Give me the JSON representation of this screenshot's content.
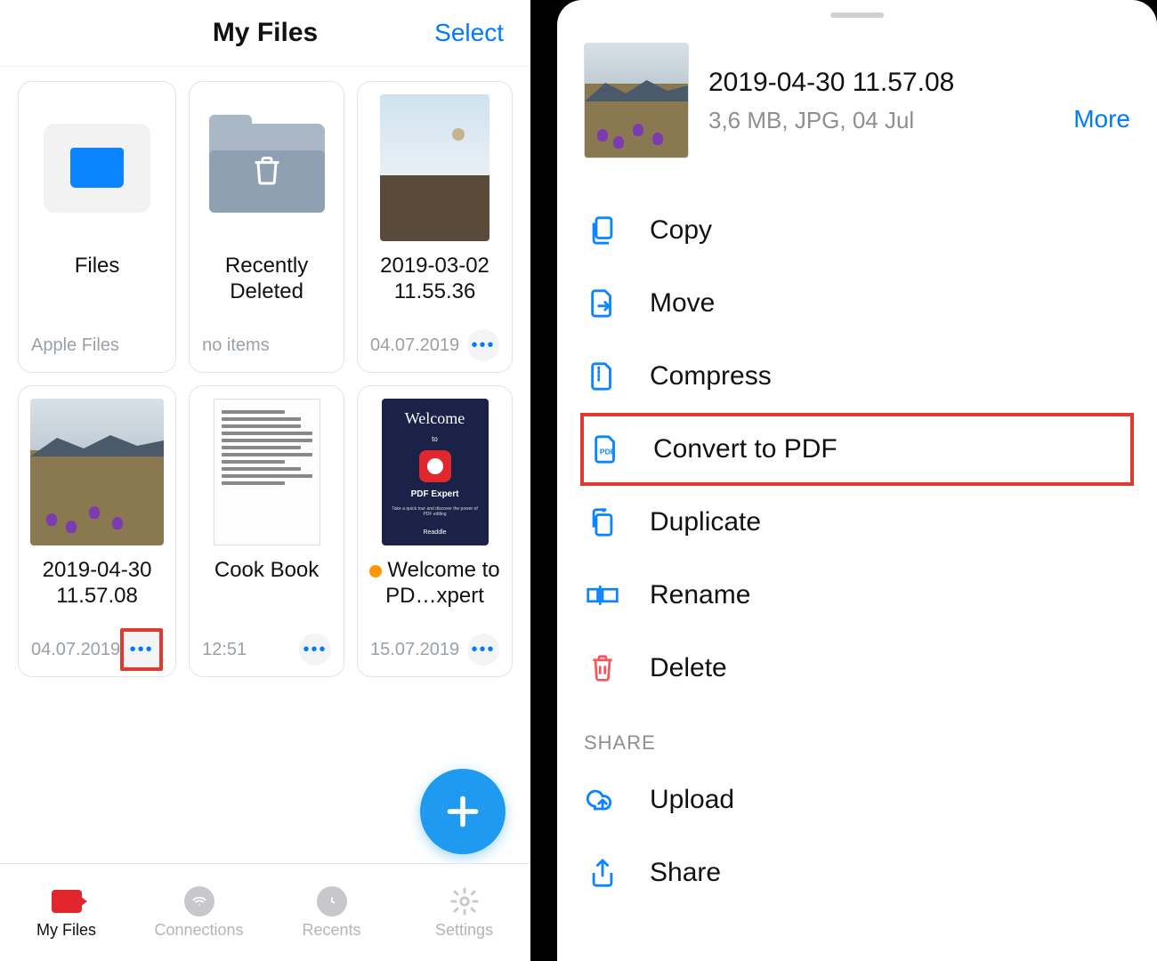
{
  "left": {
    "title": "My Files",
    "select": "Select",
    "cards": {
      "files": {
        "title": "Files",
        "meta": "Apple Files"
      },
      "deleted": {
        "title": "Recently Deleted",
        "meta": "no items"
      },
      "photo1": {
        "title": "2019-03-02 11.55.36",
        "meta": "04.07.2019"
      },
      "photo2": {
        "title": "2019-04-30 11.57.08",
        "meta": "04.07.2019"
      },
      "cookbook": {
        "title": "Cook Book",
        "meta": "12:51"
      },
      "welcome": {
        "title_prefix": "Welcome to PD…xpert",
        "meta": "15.07.2019"
      }
    },
    "welcome_thumb": {
      "heading": "Welcome",
      "to": "to",
      "app": "PDF Expert",
      "sub": "Take a quick tour and discover the power of PDF editing",
      "brand": "Readdle"
    },
    "tabs": {
      "myfiles": "My Files",
      "connections": "Connections",
      "recents": "Recents",
      "settings": "Settings"
    }
  },
  "right": {
    "title": "2019-04-30 11.57.08",
    "meta": "3,6 MB, JPG, 04 Jul",
    "more": "More",
    "actions": {
      "copy": "Copy",
      "move": "Move",
      "compress": "Compress",
      "convert": "Convert to PDF",
      "duplicate": "Duplicate",
      "rename": "Rename",
      "delete": "Delete"
    },
    "share_header": "SHARE",
    "share": {
      "upload": "Upload",
      "share": "Share"
    }
  }
}
